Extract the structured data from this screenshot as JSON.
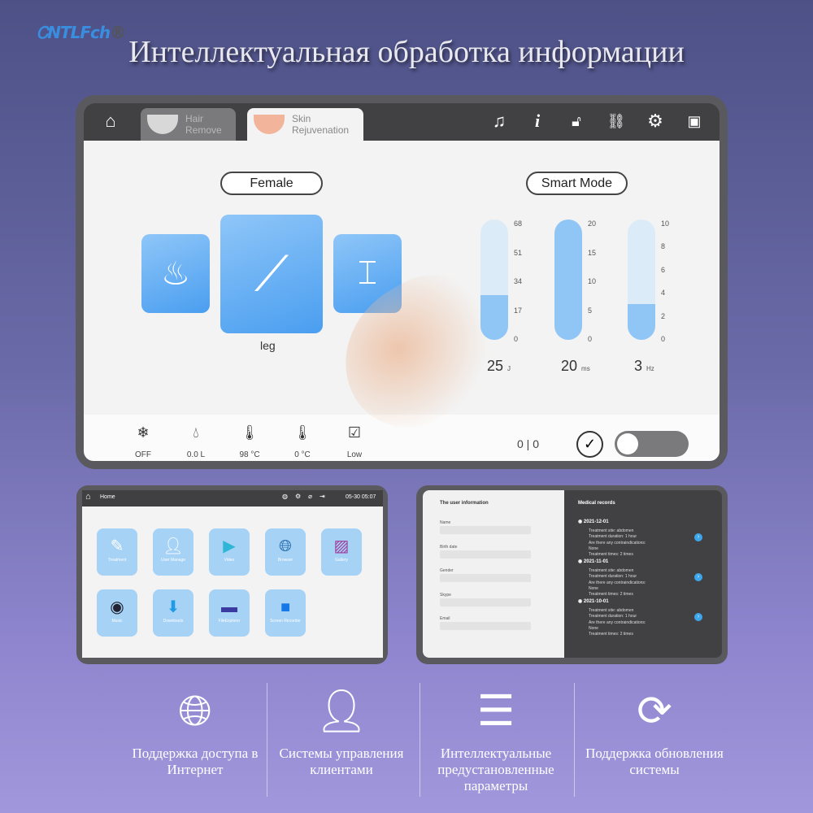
{
  "logo": {
    "text": "NTLFch"
  },
  "headline": "Интеллектуальная обработка информации",
  "main": {
    "tabs": [
      {
        "label": "Hair Remove",
        "active": false
      },
      {
        "label": "Skin Rejuvenation",
        "active": true
      }
    ],
    "toolbar_icons": [
      "home-icon",
      "music-icon",
      "info-icon",
      "lock-off-icon",
      "link-icon",
      "gear-icon",
      "user-icon"
    ],
    "gender": "Female",
    "mode": "Smart Mode",
    "selected_area": "leg",
    "sliders": [
      {
        "ticks": [
          "68",
          "51",
          "34",
          "17",
          "0"
        ],
        "value": "25",
        "unit": "J",
        "fill": 0.37
      },
      {
        "ticks": [
          "20",
          "15",
          "10",
          "5",
          "0"
        ],
        "value": "20",
        "unit": "ms",
        "fill": 1.0
      },
      {
        "ticks": [
          "10",
          "8",
          "6",
          "4",
          "2",
          "0"
        ],
        "value": "3",
        "unit": "Hz",
        "fill": 0.3
      }
    ],
    "status": [
      {
        "icon": "snowflake-icon",
        "label": "OFF"
      },
      {
        "icon": "water-drop-icon",
        "label": "0.0 L"
      },
      {
        "icon": "water-temperature-icon",
        "label": "98 °C"
      },
      {
        "icon": "thermometer-icon",
        "label": "0 °C"
      },
      {
        "icon": "water-level-icon",
        "label": "Low"
      }
    ],
    "counter": "0 | 0",
    "toggle_on": false,
    "accent": "#90c6f5"
  },
  "home_screen": {
    "title": "Home",
    "time": "05-30 05:07",
    "apps": [
      "Treatment",
      "User Manage",
      "Video",
      "Browser",
      "Gallery",
      "Music",
      "Downloads",
      "FileExplorer",
      "Screen Recorder"
    ]
  },
  "user_screen": {
    "left_title": "The user information",
    "fields": [
      "Name",
      "Birth date",
      "Gender",
      "Skype",
      "Email"
    ],
    "right_title": "Medical records",
    "records": [
      {
        "date": "2021-12-01",
        "lines": [
          "Treatment site: abdomen",
          "Treatment duration: 1 hour",
          "Are there any contraindications:",
          "None",
          "Treatment times: 2 times"
        ]
      },
      {
        "date": "2021-11-01",
        "lines": [
          "Treatment site: abdomen",
          "Treatment duration: 1 hour",
          "Are there any contraindications:",
          "None",
          "Treatment times: 2 times"
        ]
      },
      {
        "date": "2021-10-01",
        "lines": [
          "Treatment site: abdomen",
          "Treatment duration: 1 hour",
          "Are there any contraindications:",
          "None",
          "Treatment times: 2 times"
        ]
      }
    ]
  },
  "features": [
    {
      "icon": "globe-icon",
      "text": "Поддержка доступа в Интернет"
    },
    {
      "icon": "user-card-icon",
      "text": "Системы управления клиентами"
    },
    {
      "icon": "sliders-icon",
      "text": "Интеллектуальные предустановленные параметры"
    },
    {
      "icon": "refresh-icon",
      "text": "Поддержка обновления системы"
    }
  ]
}
